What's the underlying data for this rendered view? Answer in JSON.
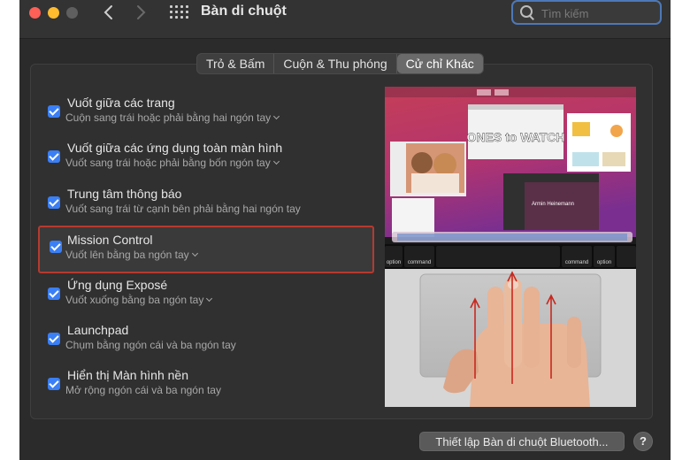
{
  "window": {
    "title": "Bàn di chuột"
  },
  "search": {
    "placeholder": "Tìm kiếm"
  },
  "tabs": [
    {
      "label": "Trỏ & Bấm",
      "active": false
    },
    {
      "label": "Cuộn & Thu phóng",
      "active": false
    },
    {
      "label": "Cử chỉ Khác",
      "active": true
    }
  ],
  "options": [
    {
      "title": "Vuốt giữa các trang",
      "subtitle": "Cuộn sang trái hoặc phải bằng hai ngón tay",
      "checked": true,
      "has_dropdown": true
    },
    {
      "title": "Vuốt giữa các ứng dụng toàn màn hình",
      "subtitle": "Vuốt sang trái hoặc phải bằng bốn ngón tay",
      "checked": true,
      "has_dropdown": true
    },
    {
      "title": "Trung tâm thông báo",
      "subtitle": "Vuốt sang trái từ cạnh bên phải bằng hai ngón tay",
      "checked": true,
      "has_dropdown": false
    },
    {
      "title": "Mission Control",
      "subtitle": "Vuốt lên bằng ba ngón tay",
      "checked": true,
      "has_dropdown": true,
      "highlighted": true
    },
    {
      "title": "Ứng dụng Exposé",
      "subtitle": "Vuốt xuống bằng ba ngón tay",
      "checked": true,
      "has_dropdown": true
    },
    {
      "title": "Launchpad",
      "subtitle": "Chụm bằng ngón cái và ba ngón tay",
      "checked": true,
      "has_dropdown": false
    },
    {
      "title": "Hiển thị Màn hình nền",
      "subtitle": "Mở rộng ngón cái và ba ngón tay",
      "checked": true,
      "has_dropdown": false
    }
  ],
  "preview": {
    "tile_heading": "ONES to WATCH",
    "profile_name": "Armin Heinemann",
    "keys": [
      "command",
      "option",
      "command",
      "option"
    ],
    "colors": {
      "wallpaper_top": "#c53e57",
      "wallpaper_bottom": "#7a2f90",
      "arrow": "#c8281e",
      "skin": "#e8b597"
    }
  },
  "footer": {
    "bluetooth_button": "Thiết lập Bàn di chuột Bluetooth...",
    "help_button": "?"
  },
  "colors": {
    "accent": "#3a7ff6",
    "highlight_border": "#b53a2f",
    "window_bg": "#2b2b2b"
  }
}
